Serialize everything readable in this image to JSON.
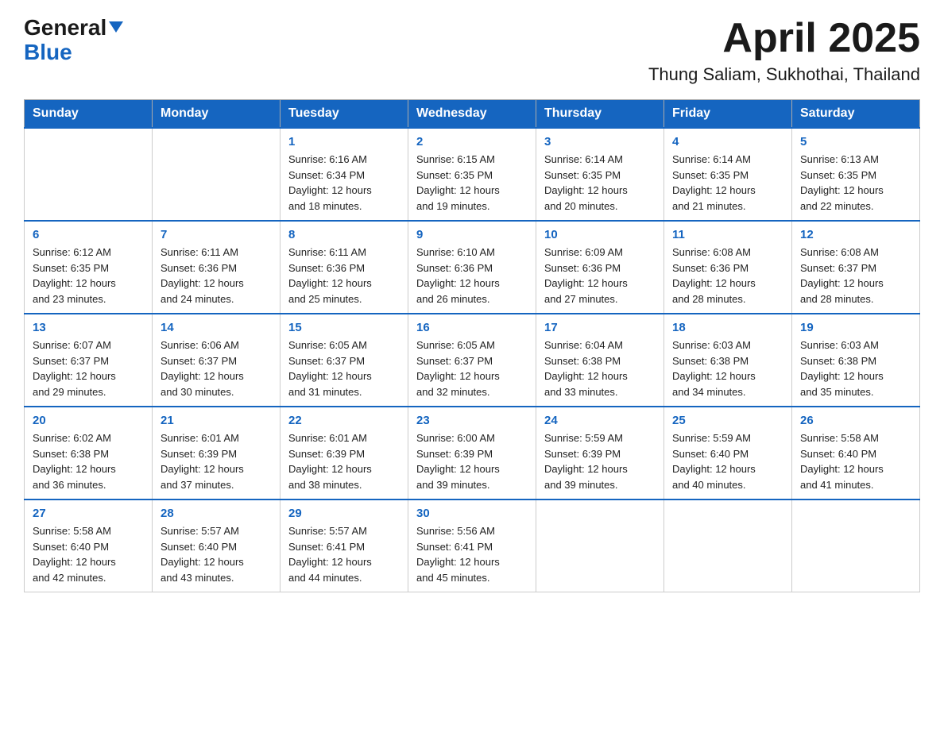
{
  "header": {
    "logo_general": "General",
    "logo_blue": "Blue",
    "month_year": "April 2025",
    "location": "Thung Saliam, Sukhothai, Thailand"
  },
  "weekdays": [
    "Sunday",
    "Monday",
    "Tuesday",
    "Wednesday",
    "Thursday",
    "Friday",
    "Saturday"
  ],
  "weeks": [
    [
      {
        "day": "",
        "info": ""
      },
      {
        "day": "",
        "info": ""
      },
      {
        "day": "1",
        "info": "Sunrise: 6:16 AM\nSunset: 6:34 PM\nDaylight: 12 hours\nand 18 minutes."
      },
      {
        "day": "2",
        "info": "Sunrise: 6:15 AM\nSunset: 6:35 PM\nDaylight: 12 hours\nand 19 minutes."
      },
      {
        "day": "3",
        "info": "Sunrise: 6:14 AM\nSunset: 6:35 PM\nDaylight: 12 hours\nand 20 minutes."
      },
      {
        "day": "4",
        "info": "Sunrise: 6:14 AM\nSunset: 6:35 PM\nDaylight: 12 hours\nand 21 minutes."
      },
      {
        "day": "5",
        "info": "Sunrise: 6:13 AM\nSunset: 6:35 PM\nDaylight: 12 hours\nand 22 minutes."
      }
    ],
    [
      {
        "day": "6",
        "info": "Sunrise: 6:12 AM\nSunset: 6:35 PM\nDaylight: 12 hours\nand 23 minutes."
      },
      {
        "day": "7",
        "info": "Sunrise: 6:11 AM\nSunset: 6:36 PM\nDaylight: 12 hours\nand 24 minutes."
      },
      {
        "day": "8",
        "info": "Sunrise: 6:11 AM\nSunset: 6:36 PM\nDaylight: 12 hours\nand 25 minutes."
      },
      {
        "day": "9",
        "info": "Sunrise: 6:10 AM\nSunset: 6:36 PM\nDaylight: 12 hours\nand 26 minutes."
      },
      {
        "day": "10",
        "info": "Sunrise: 6:09 AM\nSunset: 6:36 PM\nDaylight: 12 hours\nand 27 minutes."
      },
      {
        "day": "11",
        "info": "Sunrise: 6:08 AM\nSunset: 6:36 PM\nDaylight: 12 hours\nand 28 minutes."
      },
      {
        "day": "12",
        "info": "Sunrise: 6:08 AM\nSunset: 6:37 PM\nDaylight: 12 hours\nand 28 minutes."
      }
    ],
    [
      {
        "day": "13",
        "info": "Sunrise: 6:07 AM\nSunset: 6:37 PM\nDaylight: 12 hours\nand 29 minutes."
      },
      {
        "day": "14",
        "info": "Sunrise: 6:06 AM\nSunset: 6:37 PM\nDaylight: 12 hours\nand 30 minutes."
      },
      {
        "day": "15",
        "info": "Sunrise: 6:05 AM\nSunset: 6:37 PM\nDaylight: 12 hours\nand 31 minutes."
      },
      {
        "day": "16",
        "info": "Sunrise: 6:05 AM\nSunset: 6:37 PM\nDaylight: 12 hours\nand 32 minutes."
      },
      {
        "day": "17",
        "info": "Sunrise: 6:04 AM\nSunset: 6:38 PM\nDaylight: 12 hours\nand 33 minutes."
      },
      {
        "day": "18",
        "info": "Sunrise: 6:03 AM\nSunset: 6:38 PM\nDaylight: 12 hours\nand 34 minutes."
      },
      {
        "day": "19",
        "info": "Sunrise: 6:03 AM\nSunset: 6:38 PM\nDaylight: 12 hours\nand 35 minutes."
      }
    ],
    [
      {
        "day": "20",
        "info": "Sunrise: 6:02 AM\nSunset: 6:38 PM\nDaylight: 12 hours\nand 36 minutes."
      },
      {
        "day": "21",
        "info": "Sunrise: 6:01 AM\nSunset: 6:39 PM\nDaylight: 12 hours\nand 37 minutes."
      },
      {
        "day": "22",
        "info": "Sunrise: 6:01 AM\nSunset: 6:39 PM\nDaylight: 12 hours\nand 38 minutes."
      },
      {
        "day": "23",
        "info": "Sunrise: 6:00 AM\nSunset: 6:39 PM\nDaylight: 12 hours\nand 39 minutes."
      },
      {
        "day": "24",
        "info": "Sunrise: 5:59 AM\nSunset: 6:39 PM\nDaylight: 12 hours\nand 39 minutes."
      },
      {
        "day": "25",
        "info": "Sunrise: 5:59 AM\nSunset: 6:40 PM\nDaylight: 12 hours\nand 40 minutes."
      },
      {
        "day": "26",
        "info": "Sunrise: 5:58 AM\nSunset: 6:40 PM\nDaylight: 12 hours\nand 41 minutes."
      }
    ],
    [
      {
        "day": "27",
        "info": "Sunrise: 5:58 AM\nSunset: 6:40 PM\nDaylight: 12 hours\nand 42 minutes."
      },
      {
        "day": "28",
        "info": "Sunrise: 5:57 AM\nSunset: 6:40 PM\nDaylight: 12 hours\nand 43 minutes."
      },
      {
        "day": "29",
        "info": "Sunrise: 5:57 AM\nSunset: 6:41 PM\nDaylight: 12 hours\nand 44 minutes."
      },
      {
        "day": "30",
        "info": "Sunrise: 5:56 AM\nSunset: 6:41 PM\nDaylight: 12 hours\nand 45 minutes."
      },
      {
        "day": "",
        "info": ""
      },
      {
        "day": "",
        "info": ""
      },
      {
        "day": "",
        "info": ""
      }
    ]
  ]
}
